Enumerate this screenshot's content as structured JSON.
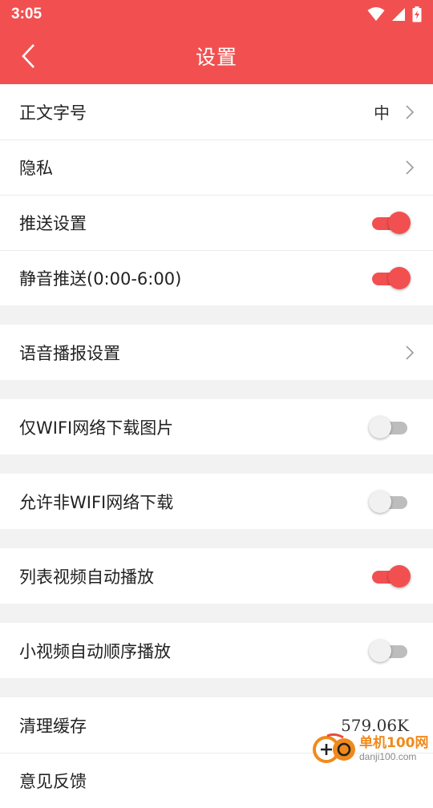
{
  "status_bar": {
    "time": "3:05"
  },
  "header": {
    "title": "设置"
  },
  "settings": {
    "font_size": {
      "label": "正文字号",
      "value": "中"
    },
    "privacy": {
      "label": "隐私"
    },
    "push": {
      "label": "推送设置",
      "enabled": true
    },
    "mute_push": {
      "label": "静音推送(0:00-6:00)",
      "enabled": true
    },
    "voice_broadcast": {
      "label": "语音播报设置"
    },
    "wifi_only_images": {
      "label": "仅WIFI网络下载图片",
      "enabled": false
    },
    "allow_non_wifi": {
      "label": "允许非WIFI网络下载",
      "enabled": false
    },
    "list_video_autoplay": {
      "label": "列表视频自动播放",
      "enabled": true
    },
    "short_video_sequential": {
      "label": "小视频自动顺序播放",
      "enabled": false
    },
    "clear_cache": {
      "label": "清理缓存",
      "value": "579.06K"
    },
    "partial_item": {
      "label": "意见反馈"
    }
  },
  "watermark": {
    "name": "单机100网",
    "url": "danji100.com"
  },
  "colors": {
    "accent": "#f25050",
    "toggle_off": "#bdbdbd"
  }
}
